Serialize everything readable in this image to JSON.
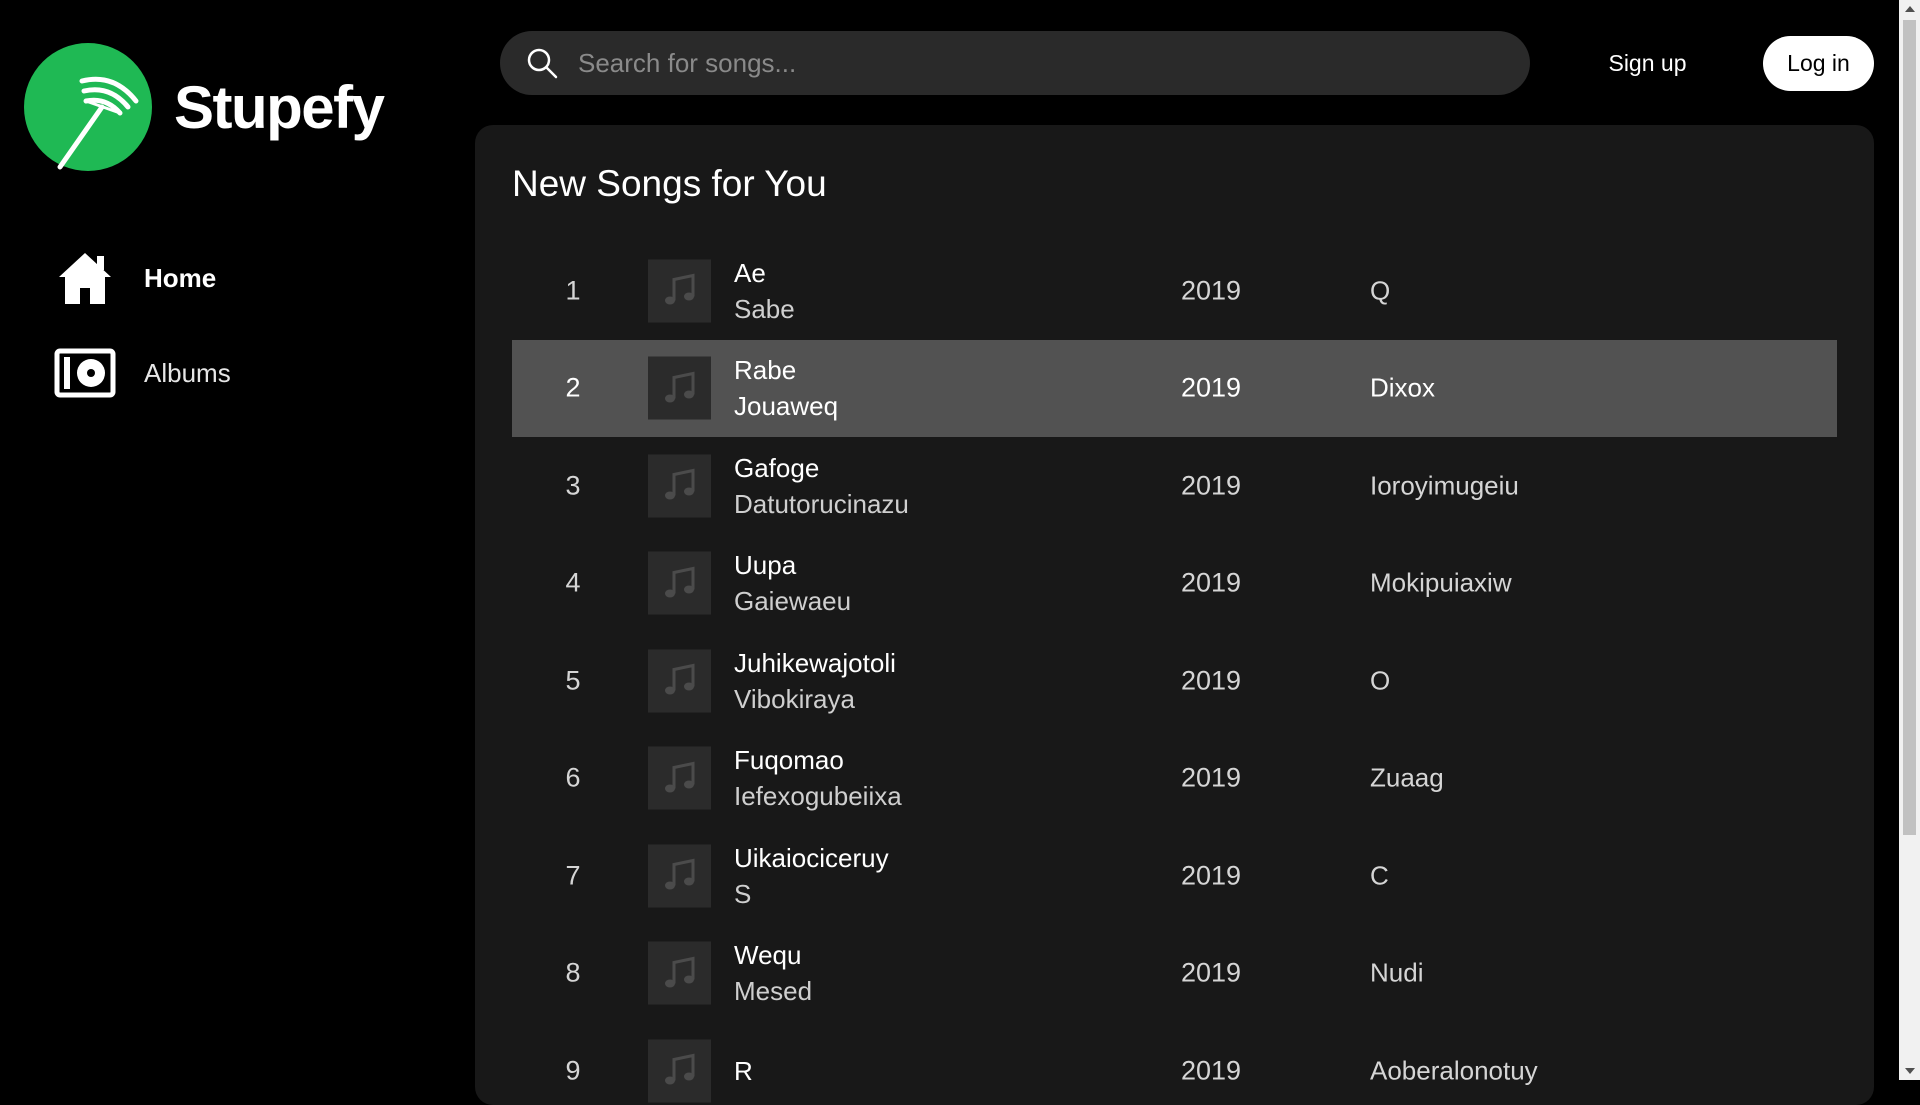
{
  "app": {
    "name": "Stupefy"
  },
  "sidebar": {
    "items": [
      {
        "label": "Home",
        "icon": "home-icon"
      },
      {
        "label": "Albums",
        "icon": "album-icon"
      }
    ]
  },
  "search": {
    "placeholder": "Search for songs...",
    "value": ""
  },
  "header": {
    "signup_label": "Sign up",
    "login_label": "Log in"
  },
  "main": {
    "title": "New Songs for You",
    "songs": [
      {
        "num": "1",
        "title": "Ae",
        "artist": "Sabe",
        "year": "2019",
        "album": "Q"
      },
      {
        "num": "2",
        "title": "Rabe",
        "artist": "Jouaweq",
        "year": "2019",
        "album": "Dixox"
      },
      {
        "num": "3",
        "title": "Gafoge",
        "artist": "Datutorucinazu",
        "year": "2019",
        "album": "Ioroyimugeiu"
      },
      {
        "num": "4",
        "title": "Uupa",
        "artist": "Gaiewaeu",
        "year": "2019",
        "album": "Mokipuiaxiw"
      },
      {
        "num": "5",
        "title": "Juhikewajotoli",
        "artist": "Vibokiraya",
        "year": "2019",
        "album": "O"
      },
      {
        "num": "6",
        "title": "Fuqomao",
        "artist": "Iefexogubeiixa",
        "year": "2019",
        "album": "Zuaag"
      },
      {
        "num": "7",
        "title": "Uikaiociceruy",
        "artist": "S",
        "year": "2019",
        "album": "C"
      },
      {
        "num": "8",
        "title": "Wequ",
        "artist": "Mesed",
        "year": "2019",
        "album": "Nudi"
      },
      {
        "num": "9",
        "title": "R",
        "artist": "",
        "year": "2019",
        "album": "Aoberalonotuy"
      }
    ]
  },
  "colors": {
    "brand": "#1fb954",
    "active_row": "#525252",
    "panel": "#181818"
  }
}
